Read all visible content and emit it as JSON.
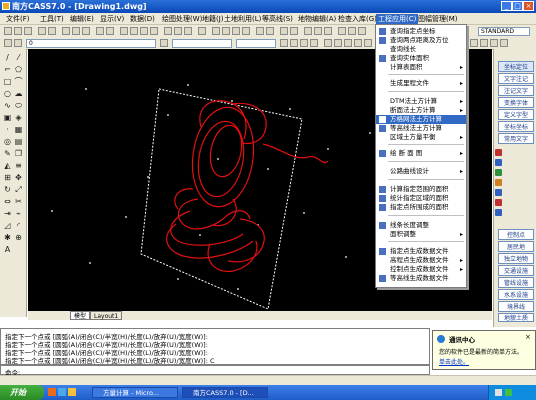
{
  "window": {
    "title": "南方CASS7.0 - [Drawing1.dwg]"
  },
  "menubar": {
    "items": [
      "文件(F)",
      "工具(T)",
      "编辑(E)",
      "显示(V)",
      "数据(D)",
      "绘图处理(W)",
      "地籍(J)",
      "土地利用(L)",
      "等高线(S)",
      "地物编辑(A)",
      "检查入库(G)",
      "工程应用(C)",
      "图幅管理(M)"
    ],
    "active_index": 11
  },
  "toolbar": {
    "layer_combo": "0",
    "style_combo": "STANDARD"
  },
  "dropdown": {
    "items": [
      {
        "label": "查询指定点坐标",
        "arrow": false
      },
      {
        "label": "查询两点距离及方位",
        "arrow": false
      },
      {
        "label": "查询线长",
        "arrow": false
      },
      {
        "label": "查询实体面积",
        "arrow": false
      },
      {
        "label": "计算表面积",
        "arrow": true
      },
      {
        "label": "生成里程文件",
        "arrow": true
      },
      {
        "label": "DTM法土方计算",
        "arrow": true
      },
      {
        "label": "断面法土方计算",
        "arrow": true
      },
      {
        "label": "方格网法土方计算",
        "arrow": false
      },
      {
        "label": "等高线法土方计算",
        "arrow": false
      },
      {
        "label": "区域土方量平衡",
        "arrow": true
      },
      {
        "label": "绘 断 面 图",
        "arrow": true
      },
      {
        "label": "公路曲线设计",
        "arrow": true
      },
      {
        "label": "计算指定范围的面积",
        "arrow": false
      },
      {
        "label": "统计指定区域的面积",
        "arrow": false
      },
      {
        "label": "指定点所围成的面积",
        "arrow": false
      },
      {
        "label": "线条长度调整",
        "arrow": false
      },
      {
        "label": "面积调整",
        "arrow": true
      },
      {
        "label": "指定点生成数据文件",
        "arrow": false
      },
      {
        "label": "高程点生成数据文件",
        "arrow": true
      },
      {
        "label": "控制点生成数据文件",
        "arrow": true
      },
      {
        "label": "等高线生成数据文件",
        "arrow": false
      }
    ],
    "highlight_index": 8
  },
  "right_panel": {
    "top_buttons": [
      "坐标定位",
      "文字注记",
      "注记文字",
      "变换字体",
      "定义字型",
      "坐标坐标",
      "常用文字"
    ],
    "bottom_buttons": [
      "控制点",
      "居民地",
      "独立地物",
      "交通设施",
      "管线设施",
      "水系设施",
      "境界线",
      "地貌土质",
      "植被圆林"
    ],
    "selected_index": 0
  },
  "tabs": [
    "模型",
    "Layout1"
  ],
  "command": {
    "lines": [
      "指定下一个点或 [圆弧(A)/闭合(C)/半宽(H)/长度(L)/放弃(U)/宽度(W)]:",
      "指定下一个点或 [圆弧(A)/闭合(C)/半宽(H)/长度(L)/放弃(U)/宽度(W)]:",
      "指定下一个点或 [圆弧(A)/闭合(C)/半宽(H)/长度(L)/放弃(U)/宽度(W)]:",
      "指定下一个点或 [圆弧(A)/闭合(C)/半宽(H)/长度(L)/放弃(U)/宽度(W)]: C"
    ],
    "prompt": "命令:"
  },
  "notification": {
    "title": "通讯中心",
    "body": "您的软件已是最新的简单方法。",
    "link": "单击此处。"
  },
  "taskbar": {
    "start": "开始",
    "tasks": [
      "方量计算 - Micro...",
      "南方CASS7.0 - [D..."
    ],
    "active_index": 1
  },
  "colors": {
    "drawing_background": "#000000",
    "polyline": "#e01010",
    "boundary": "#ffffff",
    "menu_highlight": "#316ac5"
  }
}
